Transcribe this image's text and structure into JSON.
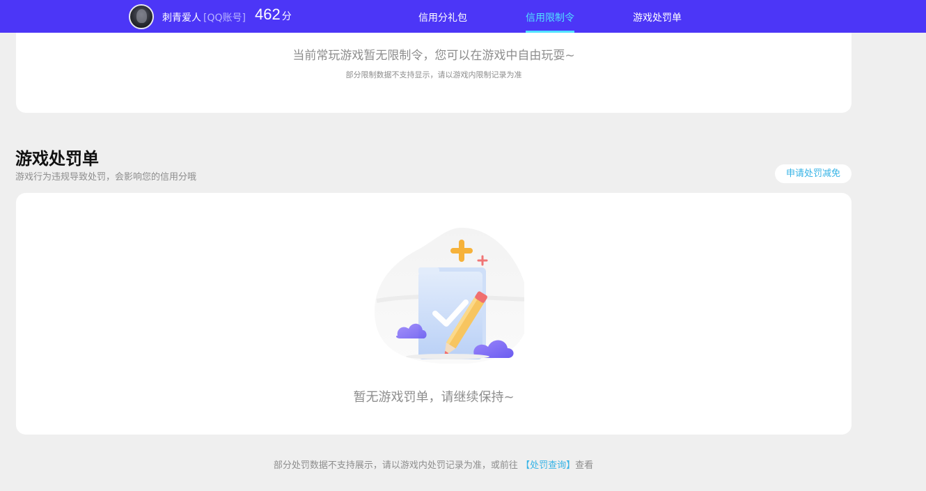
{
  "header": {
    "username": "刺青爱人",
    "account_type": "[QQ账号]",
    "score": "462",
    "score_unit": "分",
    "tabs": [
      {
        "label": "信用分礼包",
        "active": false
      },
      {
        "label": "信用限制令",
        "active": true
      },
      {
        "label": "游戏处罚单",
        "active": false
      }
    ],
    "colors": {
      "background": "#4c36f7",
      "active_tab": "#51e3ff"
    }
  },
  "restriction": {
    "message": "当前常玩游戏暂无限制令，您可以在游戏中自由玩耍~",
    "note": "部分限制数据不支持显示，请以游戏内限制记录为准"
  },
  "penalty": {
    "title": "游戏处罚单",
    "description": "游戏行为违规导致处罚，会影响您的信用分哦",
    "appeal_button": "申请处罚减免",
    "empty_message": "暂无游戏罚单，请继续保持~",
    "illustration_icon": "empty-document-check-pencil-icon"
  },
  "footer": {
    "note_prefix": "部分处罚数据不支持展示，请以游戏内处罚记录为准，或前往",
    "link_label": "【处罚查询】",
    "note_suffix": "查看"
  }
}
